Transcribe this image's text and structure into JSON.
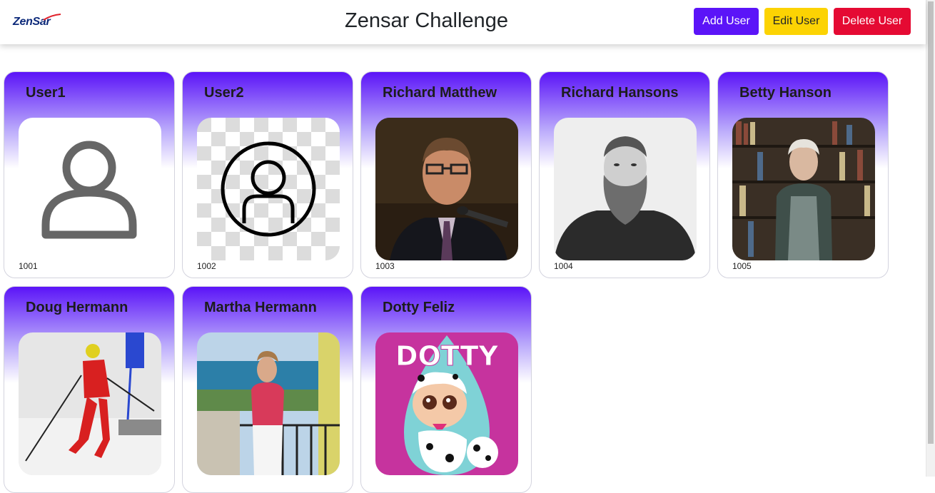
{
  "header": {
    "logo_text": "ZenSar",
    "title": "Zensar Challenge",
    "add_label": "Add User",
    "edit_label": "Edit User",
    "delete_label": "Delete User"
  },
  "users": [
    {
      "name": "User1",
      "id": "1001",
      "photo": "generic-person-icon"
    },
    {
      "name": "User2",
      "id": "1002",
      "photo": "circle-person-icon"
    },
    {
      "name": "Richard Matthew",
      "id": "1003",
      "photo": "man-at-microphone-photo"
    },
    {
      "name": "Richard Hansons",
      "id": "1004",
      "photo": "bearded-man-portrait-photo"
    },
    {
      "name": "Betty Hanson",
      "id": "1005",
      "photo": "woman-bookshelf-photo"
    },
    {
      "name": "Doug Hermann",
      "id": "",
      "photo": "skier-photo"
    },
    {
      "name": "Martha Hermann",
      "id": "",
      "photo": "woman-balcony-photo"
    },
    {
      "name": "Dotty Feliz",
      "id": "",
      "photo": "dotty-doll-artwork"
    }
  ],
  "dotty_art_text": "DOTTY",
  "colors": {
    "primary": "#5b14f8",
    "warning": "#fcd303",
    "danger": "#e50a33"
  }
}
